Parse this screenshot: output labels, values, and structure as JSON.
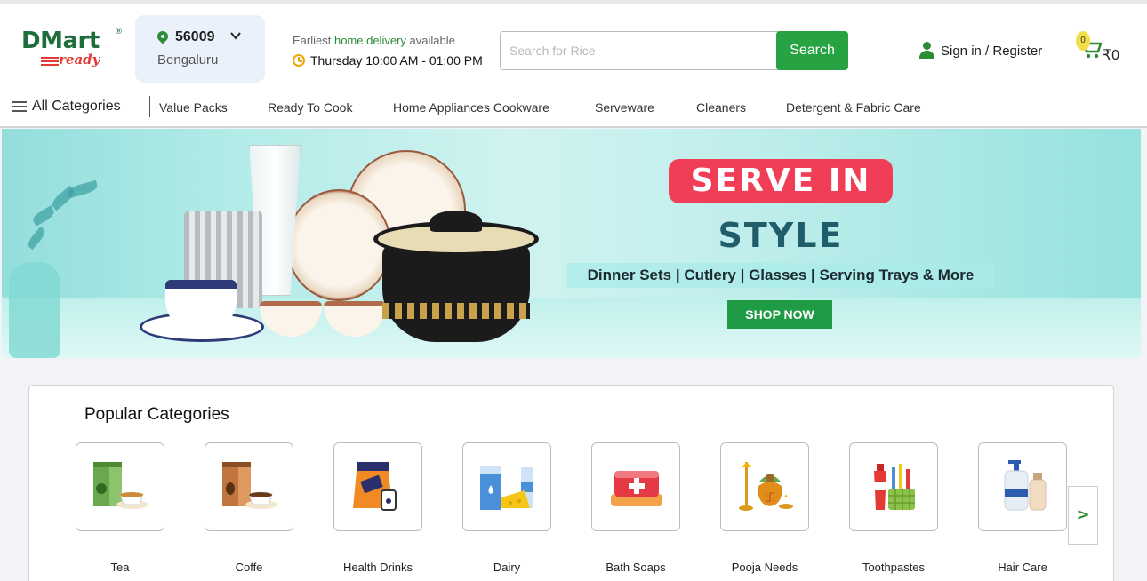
{
  "header": {
    "logo_text": "DMart",
    "logo_sub": "ready",
    "location": {
      "pincode": "56009",
      "city": "Bengaluru"
    },
    "delivery": {
      "prefix": "Earliest ",
      "highlight": "home delivery",
      "suffix": " available",
      "slot": "Thursday 10:00 AM - 01:00 PM"
    },
    "search": {
      "placeholder": "Search for Rice",
      "button_label": "Search"
    },
    "signin_label": "Sign in / Register",
    "cart": {
      "count": "0",
      "total": "₹0"
    }
  },
  "nav": {
    "all_categories": "All Categories",
    "items": [
      "Value Packs",
      "Ready To Cook",
      "Home Appliances Cookware",
      "Serveware",
      "Cleaners",
      "Detergent & Fabric Care"
    ]
  },
  "banner": {
    "headline": "SERVE IN",
    "subheadline": "STYLE",
    "tagline": "Dinner Sets | Cutlery | Glasses | Serving Trays & More",
    "cta": "SHOP NOW"
  },
  "popular": {
    "title": "Popular Categories",
    "items": [
      {
        "label": "Tea",
        "icon": "tea-icon"
      },
      {
        "label": "Coffe",
        "icon": "coffee-icon"
      },
      {
        "label": "Health Drinks",
        "icon": "health-drink-icon"
      },
      {
        "label": "Dairy",
        "icon": "dairy-icon"
      },
      {
        "label": "Bath Soaps",
        "icon": "soap-icon"
      },
      {
        "label": "Pooja Needs",
        "icon": "pooja-icon"
      },
      {
        "label": "Toothpastes",
        "icon": "toothpaste-icon"
      },
      {
        "label": "Hair Care",
        "icon": "hair-care-icon"
      }
    ],
    "next_label": ">"
  },
  "colors": {
    "brand_green": "#27a343",
    "brand_red": "#e53935",
    "pill_red": "#ef3e56"
  }
}
